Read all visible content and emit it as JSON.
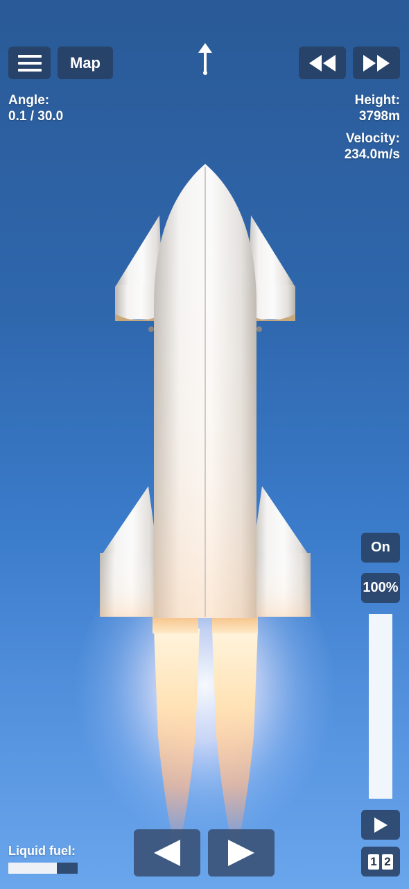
{
  "hud": {
    "menu_icon": "hamburger-icon",
    "map_label": "Map",
    "orientation_icon": "up-arrow-icon",
    "rewind_icon": "rewind-icon",
    "fast_forward_icon": "fast-forward-icon",
    "angle_label": "Angle:",
    "angle_value": "0.1 / 30.0",
    "height_label": "Height:",
    "height_value": "3798m",
    "velocity_label": "Velocity:",
    "velocity_value": "234.0m/s"
  },
  "engine": {
    "toggle_label": "On",
    "throttle_label": "100%",
    "throttle_fraction": 1.0
  },
  "fuel": {
    "label": "Liquid fuel:",
    "fraction": 0.7
  },
  "controls": {
    "rotate_left_icon": "triangle-left-icon",
    "rotate_right_icon": "triangle-right-icon",
    "stage_icon": "play-icon",
    "stage_numbers": [
      "1",
      "2"
    ]
  },
  "colors": {
    "sky_top": "#2a5a97",
    "sky_bottom": "#6aa6ec",
    "button_bg": "#283e60",
    "rocket_steel": "#ecebeb",
    "flame": "#ffd9a0"
  }
}
